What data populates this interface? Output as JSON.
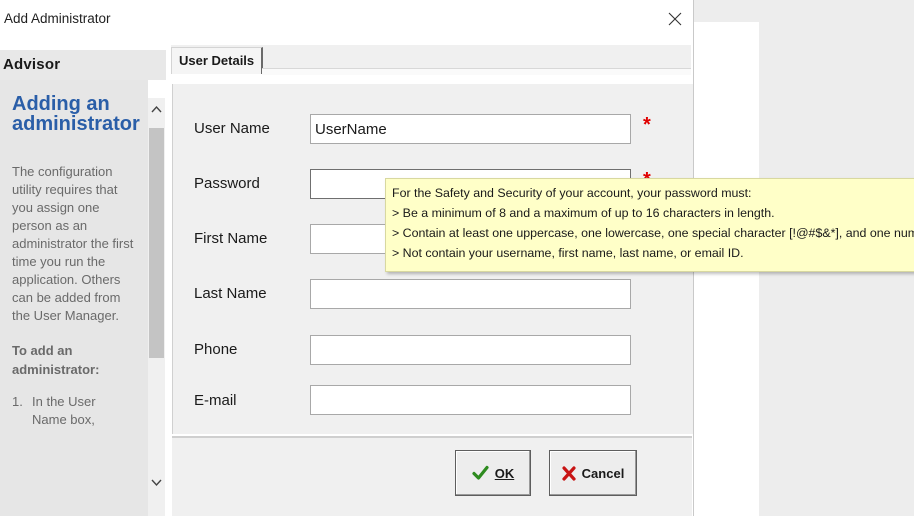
{
  "window": {
    "title": "Add Administrator",
    "close_icon": "close-icon"
  },
  "advisor": {
    "header": "Advisor",
    "title": "Adding an administrator",
    "paragraph": "The configuration utility requires that you assign one person as an administrator the first time you run the application. Others can be added from the User Manager.",
    "subheading": "To add an administrator:",
    "steps": [
      {
        "number": "1.",
        "text": "In the User Name box,"
      }
    ]
  },
  "tabs": [
    {
      "label": "User Details",
      "selected": true
    }
  ],
  "form": {
    "fields": [
      {
        "label": "User Name",
        "value": "UserName",
        "required": true
      },
      {
        "label": "Password",
        "value": "",
        "required": true
      },
      {
        "label": "First Name",
        "value": "",
        "required": false
      },
      {
        "label": "Last Name",
        "value": "",
        "required": false
      },
      {
        "label": "Phone",
        "value": "",
        "required": false
      },
      {
        "label": "E-mail",
        "value": "",
        "required": false
      }
    ],
    "required_marker": "*"
  },
  "buttons": {
    "ok": {
      "label": "OK",
      "icon": "checkmark-icon"
    },
    "cancel": {
      "label": "Cancel",
      "icon": "x-icon"
    }
  },
  "tooltip": {
    "lines": [
      "For the Safety and Security of your account, your password must:",
      "> Be a minimum of 8 and a maximum of up to 16 characters in length.",
      "> Contain at least one uppercase, one lowercase, one special character [!@#$&*], and one number",
      "> Not contain your username, first name, last name, or email ID."
    ]
  },
  "colors": {
    "accent_title": "#2a5ea8",
    "required_marker": "#e00000",
    "ok_check": "#2e8b1f",
    "cancel_x": "#c81414",
    "tooltip_bg": "#ffffc8"
  }
}
